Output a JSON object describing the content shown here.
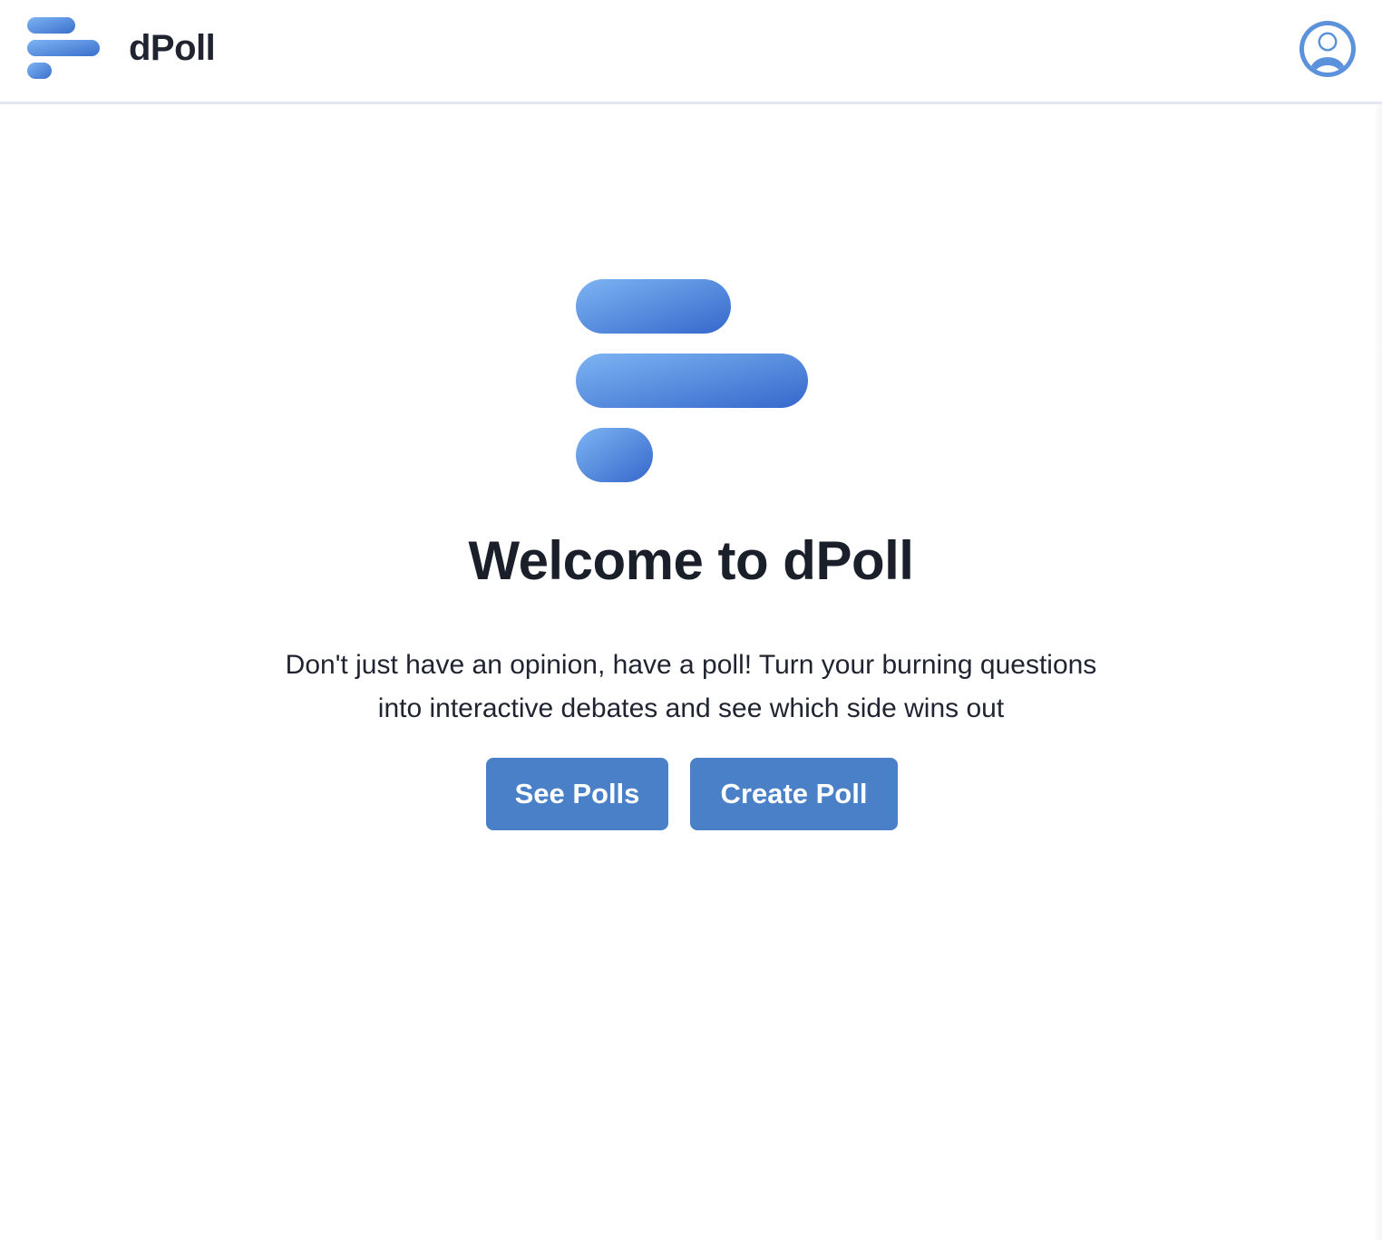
{
  "brand": {
    "name": "dPoll"
  },
  "colors": {
    "accent": "#4a80c8",
    "logo_gradient_start": "#7db4f2",
    "logo_gradient_end": "#3a6fcd",
    "avatar": "#5b92db",
    "divider": "#e3e8ef"
  },
  "header": {
    "account_icon": "user-circle-icon"
  },
  "hero": {
    "title": "Welcome to dPoll",
    "subtitle_line1": "Don't just have an opinion, have a poll! Turn your burning questions",
    "subtitle_line2": "into interactive debates and see which side wins out"
  },
  "actions": {
    "see_polls_label": "See Polls",
    "create_poll_label": "Create Poll"
  }
}
